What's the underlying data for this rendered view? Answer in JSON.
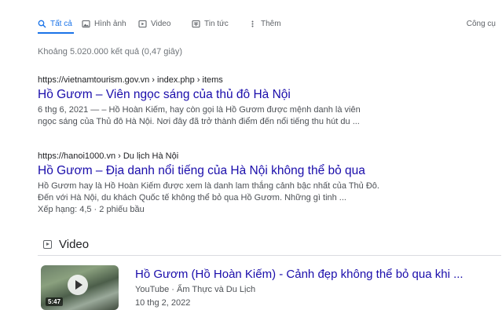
{
  "tabs": [
    {
      "label": "Tất cả",
      "icon": "search-icon",
      "active": true
    },
    {
      "label": "Hình ảnh",
      "icon": "image-icon"
    },
    {
      "label": "Video",
      "icon": "video-icon"
    },
    {
      "label": "Tin tức",
      "icon": "news-icon"
    },
    {
      "label": "Thêm",
      "icon": "more-vert-icon"
    }
  ],
  "tools_label": "Công cụ",
  "stats": "Khoảng 5.020.000 kết quả (0,47 giây)",
  "results": [
    {
      "url": "https://vietnamtourism.gov.vn › index.php › items",
      "title": "Hồ Gươm – Viên ngọc sáng của thủ đô Hà Nội",
      "snippet_line1": "6 thg 6, 2021 — – Hồ Hoàn Kiếm, hay còn gọi là Hồ Gươm được mệnh danh là viên",
      "snippet_line2": "ngọc sáng của Thủ đô Hà Nội. Nơi đây đã trở thành điểm đến nổi tiếng thu hút du ..."
    },
    {
      "url": "https://hanoi1000.vn › Du lịch Hà Nội",
      "title": "Hồ Gươm – Địa danh nổi tiếng của Hà Nội không thể bỏ qua",
      "snippet_line1": "Hồ Gươm hay là Hồ Hoàn Kiếm được xem là danh lam thắng cảnh bậc nhất của Thủ Đô.",
      "snippet_line2": "Đến với Hà Nội, du khách Quốc tế không thể bỏ qua Hồ Gươm. Những gì tinh ...",
      "rating": "Xếp hạng: 4,5 · 2 phiếu bầu"
    }
  ],
  "video_section": {
    "heading": "Video",
    "item": {
      "title": "Hồ Gươm (Hồ Hoàn Kiếm) - Cảnh đẹp không thể bỏ qua khi ...",
      "source": "YouTube · Ẩm Thực và Du Lịch",
      "date": "10 thg 2, 2022",
      "duration": "5:47"
    }
  },
  "colors": {
    "link": "#1a0dab",
    "accent": "#1a73e8",
    "muted": "#70757a"
  }
}
